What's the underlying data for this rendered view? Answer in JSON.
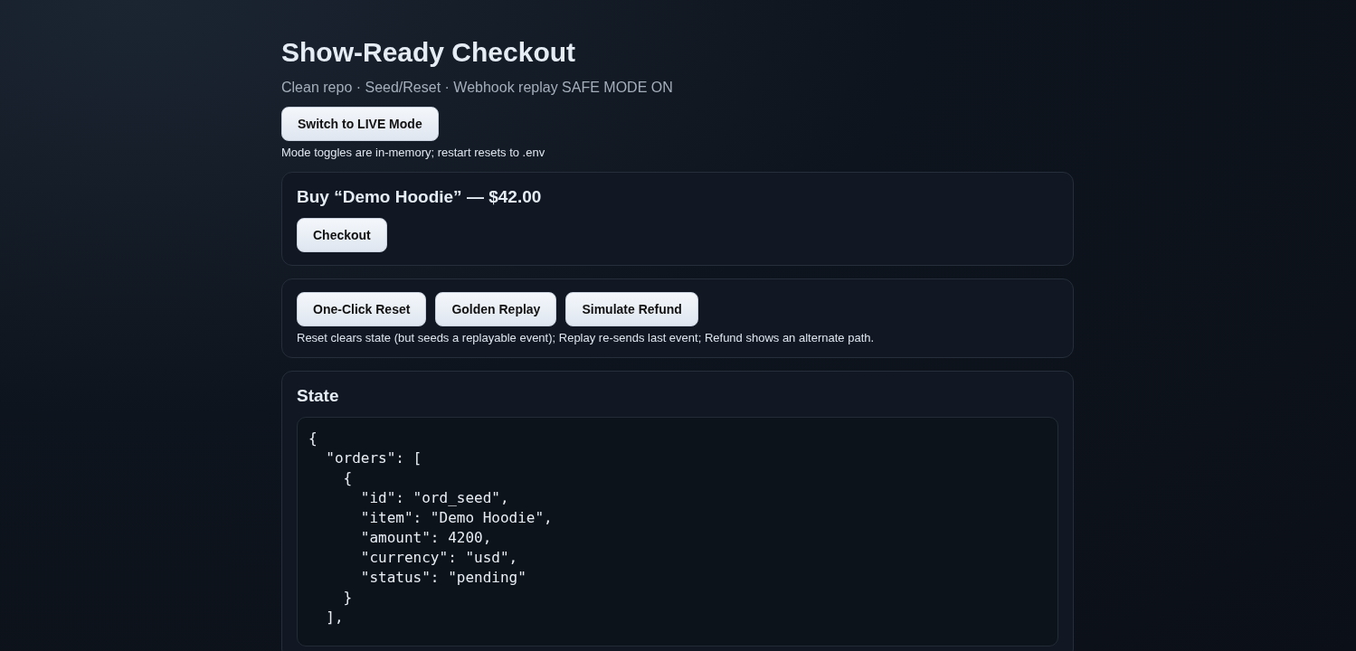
{
  "header": {
    "title": "Show-Ready Checkout",
    "subtitle": "Clean repo · Seed/Reset · Webhook replay SAFE MODE ON"
  },
  "mode": {
    "button": "Switch to LIVE Mode",
    "note": "Mode toggles are in-memory; restart resets to .env"
  },
  "product": {
    "title": "Buy “Demo Hoodie” — $42.00",
    "button": "Checkout"
  },
  "actions": {
    "buttons": [
      "One-Click Reset",
      "Golden Replay",
      "Simulate Refund"
    ],
    "note": "Reset clears state (but seeds a replayable event); Replay re-sends last event; Refund shows an alternate path."
  },
  "state": {
    "title": "State",
    "code_lines": [
      "{",
      "  \"orders\": [",
      "    {",
      "      \"id\": \"ord_seed\",",
      "      \"item\": \"Demo Hoodie\",",
      "      \"amount\": 4200,",
      "      \"currency\": \"usd\",",
      "      \"status\": \"pending\"",
      "    }",
      "  ],"
    ]
  }
}
